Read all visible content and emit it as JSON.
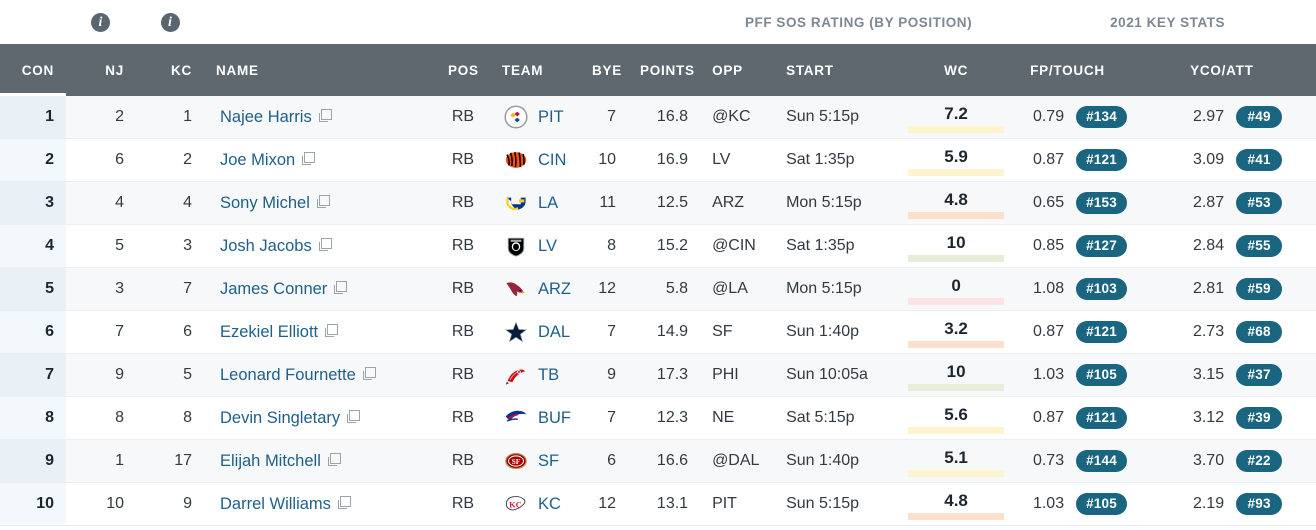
{
  "group_header": {
    "info_icon_1": "info-icon",
    "info_icon_2": "info-icon",
    "sos_label": "PFF SOS RATING (BY POSITION)",
    "key_stats_label": "2021 KEY STATS"
  },
  "columns": {
    "con": "CON",
    "nj": "NJ",
    "kc": "KC",
    "name": "NAME",
    "pos": "POS",
    "team": "TEAM",
    "bye": "BYE",
    "points": "POINTS",
    "opp": "OPP",
    "start": "START",
    "wc": "WC",
    "fp_touch": "FP/TOUCH",
    "yco_att": "YCO/ATT"
  },
  "theme": {
    "header_bg": "#5f686f",
    "con_header_bg": "#373e44",
    "group_bg": "#e3e8ed",
    "link_color": "#1f6089",
    "pill_bg": "#1a6680",
    "bar_green": "#4e8b22",
    "bar_yellow": "#d2b030",
    "bar_orange": "#c6461a",
    "bar_red": "#8f1020",
    "track_yellow": "#fdf3cf",
    "track_orange": "#fcdfcd",
    "track_red": "#fbe3e5",
    "con_cell_bg": "#e9f1f7"
  },
  "rows": [
    {
      "con": "1",
      "nj": "2",
      "kc": "1",
      "name": "Najee Harris",
      "copy_icon": "copy-icon",
      "pos": "RB",
      "team": "PIT",
      "team_logo": "steelers-logo",
      "bye": "7",
      "points": "16.8",
      "opp": "@KC",
      "start": "Sun 5:15p",
      "wc_value": "7.2",
      "wc_pct": 86,
      "wc_color": "#d2b030",
      "wc_track": "#fdf3cf",
      "fp_touch": "0.79",
      "fp_touch_rank": "#134",
      "yco_att": "2.97",
      "yco_att_rank": "#49"
    },
    {
      "con": "2",
      "nj": "6",
      "kc": "2",
      "name": "Joe Mixon",
      "copy_icon": "copy-icon",
      "pos": "RB",
      "team": "CIN",
      "team_logo": "bengals-logo",
      "bye": "10",
      "points": "16.9",
      "opp": "LV",
      "start": "Sat 1:35p",
      "wc_value": "5.9",
      "wc_pct": 73,
      "wc_color": "#d2b030",
      "wc_track": "#fdf3cf",
      "fp_touch": "0.87",
      "fp_touch_rank": "#121",
      "yco_att": "3.09",
      "yco_att_rank": "#41"
    },
    {
      "con": "3",
      "nj": "4",
      "kc": "4",
      "name": "Sony Michel",
      "copy_icon": "copy-icon",
      "pos": "RB",
      "team": "LA",
      "team_logo": "rams-logo",
      "bye": "11",
      "points": "12.5",
      "opp": "ARZ",
      "start": "Mon 5:15p",
      "wc_value": "4.8",
      "wc_pct": 58,
      "wc_color": "#c6461a",
      "wc_track": "#fcdfcd",
      "fp_touch": "0.65",
      "fp_touch_rank": "#153",
      "yco_att": "2.87",
      "yco_att_rank": "#53"
    },
    {
      "con": "4",
      "nj": "5",
      "kc": "3",
      "name": "Josh Jacobs",
      "copy_icon": "copy-icon",
      "pos": "RB",
      "team": "LV",
      "team_logo": "raiders-logo",
      "bye": "8",
      "points": "15.2",
      "opp": "@CIN",
      "start": "Sat 1:35p",
      "wc_value": "10",
      "wc_pct": 100,
      "wc_color": "#4e8b22",
      "wc_track": "#e6eed9",
      "fp_touch": "0.85",
      "fp_touch_rank": "#127",
      "yco_att": "2.84",
      "yco_att_rank": "#55"
    },
    {
      "con": "5",
      "nj": "3",
      "kc": "7",
      "name": "James Conner",
      "copy_icon": "copy-icon",
      "pos": "RB",
      "team": "ARZ",
      "team_logo": "cardinals-logo",
      "bye": "12",
      "points": "5.8",
      "opp": "@LA",
      "start": "Mon 5:15p",
      "wc_value": "0",
      "wc_pct": 5,
      "wc_color": "#8f1020",
      "wc_track": "#fbe3e5",
      "fp_touch": "1.08",
      "fp_touch_rank": "#103",
      "yco_att": "2.81",
      "yco_att_rank": "#59"
    },
    {
      "con": "6",
      "nj": "7",
      "kc": "6",
      "name": "Ezekiel Elliott",
      "copy_icon": "copy-icon",
      "pos": "RB",
      "team": "DAL",
      "team_logo": "cowboys-logo",
      "bye": "7",
      "points": "14.9",
      "opp": "SF",
      "start": "Sun 1:40p",
      "wc_value": "3.2",
      "wc_pct": 45,
      "wc_color": "#c6461a",
      "wc_track": "#fcdfcd",
      "fp_touch": "0.87",
      "fp_touch_rank": "#121",
      "yco_att": "2.73",
      "yco_att_rank": "#68"
    },
    {
      "con": "7",
      "nj": "9",
      "kc": "5",
      "name": "Leonard Fournette",
      "copy_icon": "copy-icon",
      "pos": "RB",
      "team": "TB",
      "team_logo": "buccaneers-logo",
      "bye": "9",
      "points": "17.3",
      "opp": "PHI",
      "start": "Sun 10:05a",
      "wc_value": "10",
      "wc_pct": 100,
      "wc_color": "#4e8b22",
      "wc_track": "#e6eed9",
      "fp_touch": "1.03",
      "fp_touch_rank": "#105",
      "yco_att": "3.15",
      "yco_att_rank": "#37"
    },
    {
      "con": "8",
      "nj": "8",
      "kc": "8",
      "name": "Devin Singletary",
      "copy_icon": "copy-icon",
      "pos": "RB",
      "team": "BUF",
      "team_logo": "bills-logo",
      "bye": "7",
      "points": "12.3",
      "opp": "NE",
      "start": "Sat 5:15p",
      "wc_value": "5.6",
      "wc_pct": 70,
      "wc_color": "#d2b030",
      "wc_track": "#fdf3cf",
      "fp_touch": "0.87",
      "fp_touch_rank": "#121",
      "yco_att": "3.12",
      "yco_att_rank": "#39"
    },
    {
      "con": "9",
      "nj": "1",
      "kc": "17",
      "name": "Elijah Mitchell",
      "copy_icon": "copy-icon",
      "pos": "RB",
      "team": "SF",
      "team_logo": "49ers-logo",
      "bye": "6",
      "points": "16.6",
      "opp": "@DAL",
      "start": "Sun 1:40p",
      "wc_value": "5.1",
      "wc_pct": 65,
      "wc_color": "#d2b030",
      "wc_track": "#fdf3cf",
      "fp_touch": "0.73",
      "fp_touch_rank": "#144",
      "yco_att": "3.70",
      "yco_att_rank": "#22"
    },
    {
      "con": "10",
      "nj": "10",
      "kc": "9",
      "name": "Darrel Williams",
      "copy_icon": "copy-icon",
      "pos": "RB",
      "team": "KC",
      "team_logo": "chiefs-logo",
      "bye": "12",
      "points": "13.1",
      "opp": "PIT",
      "start": "Sun 5:15p",
      "wc_value": "4.8",
      "wc_pct": 62,
      "wc_color": "#c6461a",
      "wc_track": "#fcdfcd",
      "fp_touch": "1.03",
      "fp_touch_rank": "#105",
      "yco_att": "2.19",
      "yco_att_rank": "#93"
    }
  ]
}
